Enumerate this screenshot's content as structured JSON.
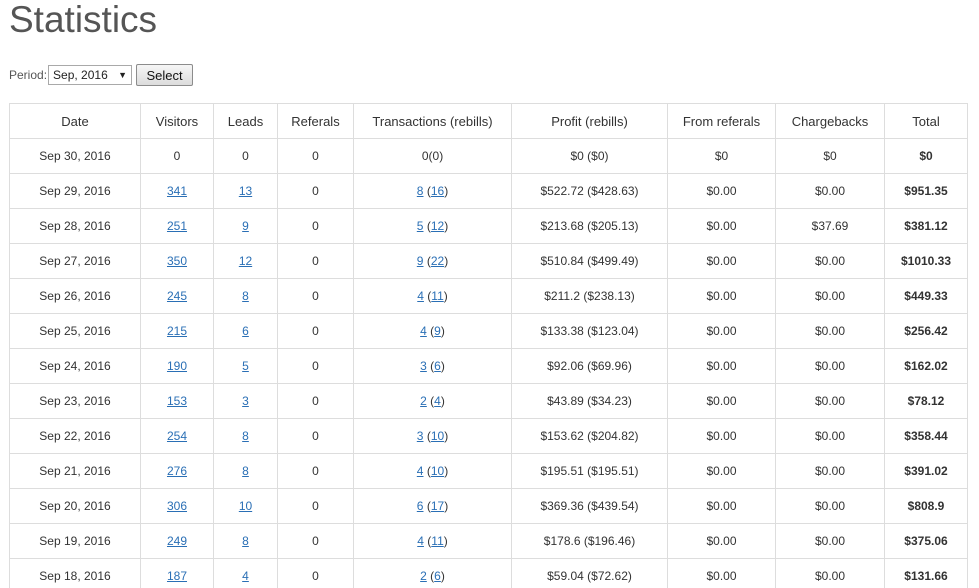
{
  "page": {
    "title": "Statistics"
  },
  "period": {
    "label": "Period:",
    "selected": "Sep, 2016",
    "button_label": "Select"
  },
  "table": {
    "headers": [
      "Date",
      "Visitors",
      "Leads",
      "Referals",
      "Transactions (rebills)",
      "Profit (rebills)",
      "From referals",
      "Chargebacks",
      "Total"
    ],
    "rows": [
      {
        "date": "Sep 30, 2016",
        "visitors": "0",
        "leads": "0",
        "referals": "0",
        "tx": "0",
        "rebills": "0",
        "profit": "$0 ($0)",
        "from_referals": "$0",
        "chargebacks": "$0",
        "total": "$0",
        "linked": false
      },
      {
        "date": "Sep 29, 2016",
        "visitors": "341",
        "leads": "13",
        "referals": "0",
        "tx": "8",
        "rebills": "16",
        "profit": "$522.72 ($428.63)",
        "from_referals": "$0.00",
        "chargebacks": "$0.00",
        "total": "$951.35",
        "linked": true
      },
      {
        "date": "Sep 28, 2016",
        "visitors": "251",
        "leads": "9",
        "referals": "0",
        "tx": "5",
        "rebills": "12",
        "profit": "$213.68 ($205.13)",
        "from_referals": "$0.00",
        "chargebacks": "$37.69",
        "total": "$381.12",
        "linked": true
      },
      {
        "date": "Sep 27, 2016",
        "visitors": "350",
        "leads": "12",
        "referals": "0",
        "tx": "9",
        "rebills": "22",
        "profit": "$510.84 ($499.49)",
        "from_referals": "$0.00",
        "chargebacks": "$0.00",
        "total": "$1010.33",
        "linked": true
      },
      {
        "date": "Sep 26, 2016",
        "visitors": "245",
        "leads": "8",
        "referals": "0",
        "tx": "4",
        "rebills": "11",
        "profit": "$211.2 ($238.13)",
        "from_referals": "$0.00",
        "chargebacks": "$0.00",
        "total": "$449.33",
        "linked": true
      },
      {
        "date": "Sep 25, 2016",
        "visitors": "215",
        "leads": "6",
        "referals": "0",
        "tx": "4",
        "rebills": "9",
        "profit": "$133.38 ($123.04)",
        "from_referals": "$0.00",
        "chargebacks": "$0.00",
        "total": "$256.42",
        "linked": true
      },
      {
        "date": "Sep 24, 2016",
        "visitors": "190",
        "leads": "5",
        "referals": "0",
        "tx": "3",
        "rebills": "6",
        "profit": "$92.06 ($69.96)",
        "from_referals": "$0.00",
        "chargebacks": "$0.00",
        "total": "$162.02",
        "linked": true
      },
      {
        "date": "Sep 23, 2016",
        "visitors": "153",
        "leads": "3",
        "referals": "0",
        "tx": "2",
        "rebills": "4",
        "profit": "$43.89 ($34.23)",
        "from_referals": "$0.00",
        "chargebacks": "$0.00",
        "total": "$78.12",
        "linked": true
      },
      {
        "date": "Sep 22, 2016",
        "visitors": "254",
        "leads": "8",
        "referals": "0",
        "tx": "3",
        "rebills": "10",
        "profit": "$153.62 ($204.82)",
        "from_referals": "$0.00",
        "chargebacks": "$0.00",
        "total": "$358.44",
        "linked": true
      },
      {
        "date": "Sep 21, 2016",
        "visitors": "276",
        "leads": "8",
        "referals": "0",
        "tx": "4",
        "rebills": "10",
        "profit": "$195.51 ($195.51)",
        "from_referals": "$0.00",
        "chargebacks": "$0.00",
        "total": "$391.02",
        "linked": true
      },
      {
        "date": "Sep 20, 2016",
        "visitors": "306",
        "leads": "10",
        "referals": "0",
        "tx": "6",
        "rebills": "17",
        "profit": "$369.36 ($439.54)",
        "from_referals": "$0.00",
        "chargebacks": "$0.00",
        "total": "$808.9",
        "linked": true
      },
      {
        "date": "Sep 19, 2016",
        "visitors": "249",
        "leads": "8",
        "referals": "0",
        "tx": "4",
        "rebills": "11",
        "profit": "$178.6 ($196.46)",
        "from_referals": "$0.00",
        "chargebacks": "$0.00",
        "total": "$375.06",
        "linked": true
      },
      {
        "date": "Sep 18, 2016",
        "visitors": "187",
        "leads": "4",
        "referals": "0",
        "tx": "2",
        "rebills": "6",
        "profit": "$59.04 ($72.62)",
        "from_referals": "$0.00",
        "chargebacks": "$0.00",
        "total": "$131.66",
        "linked": true
      }
    ]
  },
  "colors": {
    "link": "#2a6fb5",
    "border": "#dddddd",
    "text": "#333333"
  }
}
